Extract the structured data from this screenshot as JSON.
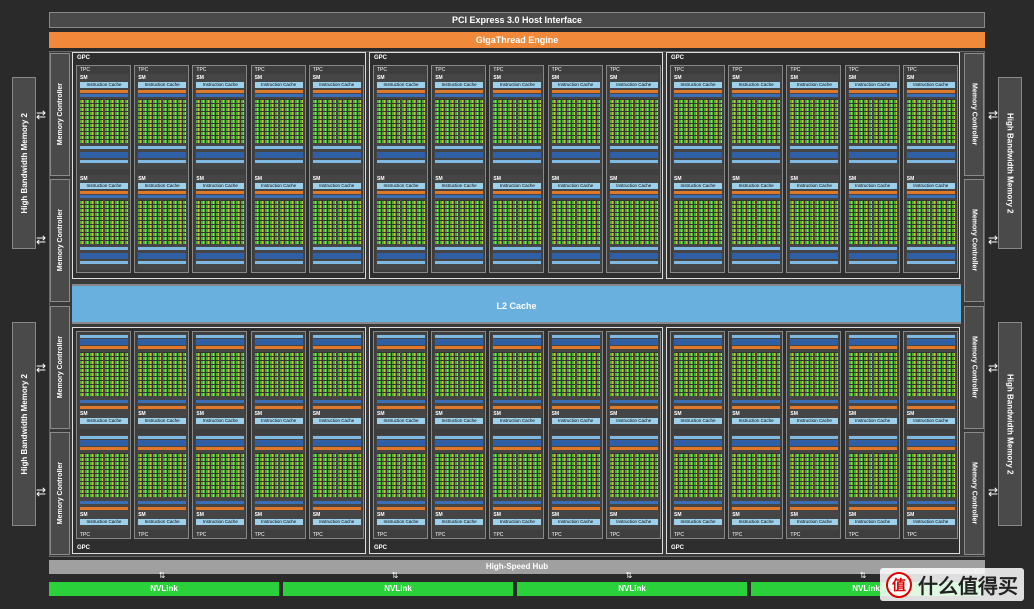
{
  "pci": "PCI Express 3.0 Host Interface",
  "giga": "GigaThread Engine",
  "hbm_label": "High Bandwidth Memory 2",
  "mc_label": "Memory Controller",
  "l2": "L2 Cache",
  "gpc_label": "GPC",
  "tpc_label": "TPC",
  "sm_label": "SM",
  "icache_label": "Instruction Cache",
  "hub": "High-Speed Hub",
  "nvlink": [
    "NVLink",
    "NVLink",
    "NVLink",
    "NVLink"
  ],
  "watermark": {
    "text": "什么值得买",
    "logo": "值"
  },
  "colors": {
    "giga": "#f08a3a",
    "l2": "#6ab0de",
    "nvlink": "#2ad13a",
    "core_green": "#4cae36",
    "core_yellow": "#c8c23a"
  }
}
